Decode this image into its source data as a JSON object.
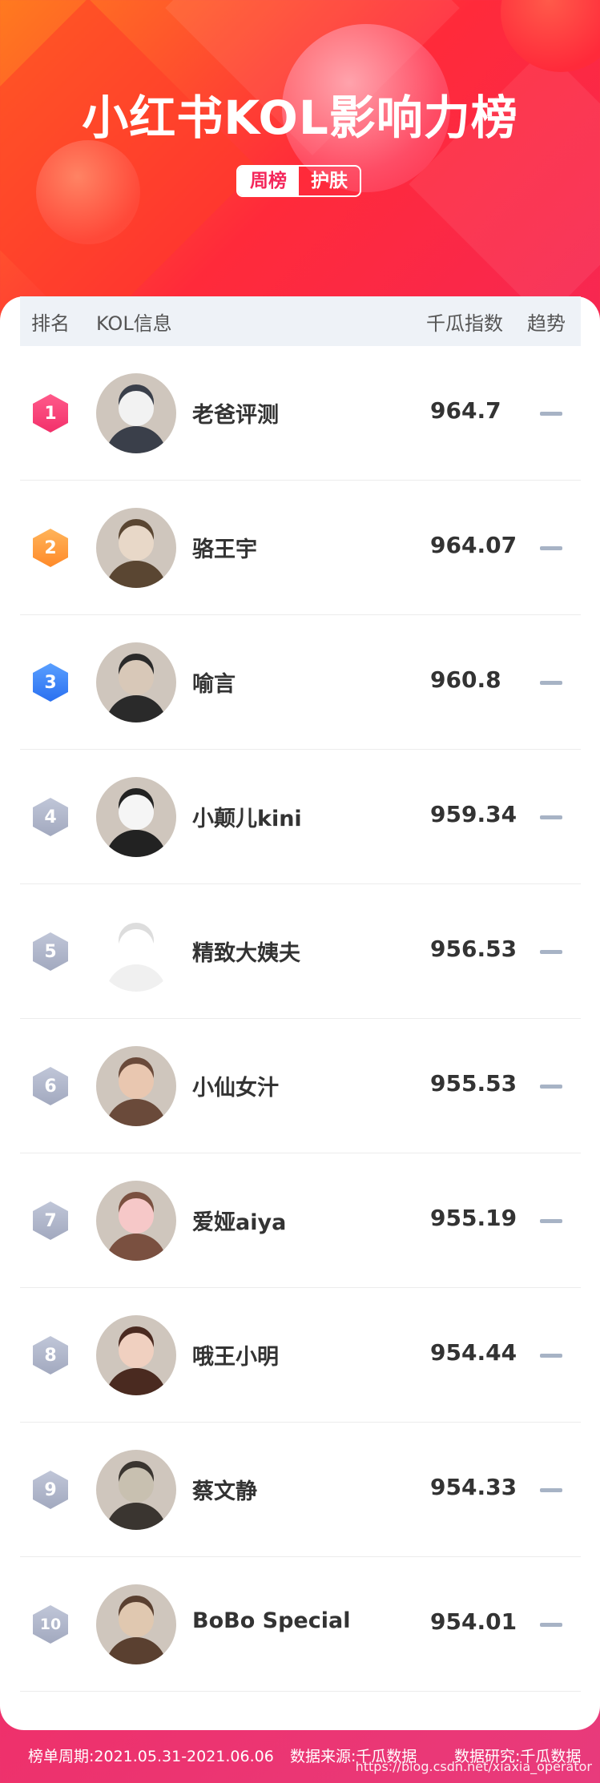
{
  "header": {
    "title": "小红书KOL影响力榜",
    "tabs": [
      {
        "label": "周榜",
        "active": true
      },
      {
        "label": "护肤",
        "active": false
      }
    ]
  },
  "table": {
    "columns": {
      "rank": "排名",
      "kol": "KOL信息",
      "index": "千瓜指数",
      "trend": "趋势"
    },
    "rows": [
      {
        "rank": "1",
        "name": "老爸评测",
        "score": "964.7",
        "avatar": "avatar-man-white-shirt"
      },
      {
        "rank": "2",
        "name": "骆王宇",
        "score": "964.07",
        "avatar": "avatar-young-man"
      },
      {
        "rank": "3",
        "name": "喻言",
        "score": "960.8",
        "avatar": "avatar-woman-dark-hair"
      },
      {
        "rank": "4",
        "name": "小颠儿kini",
        "score": "959.34",
        "avatar": "avatar-man-cap"
      },
      {
        "rank": "5",
        "name": "精致大姨夫",
        "score": "956.53",
        "avatar": "avatar-cartoon-doctor"
      },
      {
        "rank": "6",
        "name": "小仙女汁",
        "score": "955.53",
        "avatar": "avatar-woman-brown-hair"
      },
      {
        "rank": "7",
        "name": "爱娅aiya",
        "score": "955.19",
        "avatar": "avatar-woman-pink-bg"
      },
      {
        "rank": "8",
        "name": "哦王小明",
        "score": "954.44",
        "avatar": "avatar-woman-smiling"
      },
      {
        "rank": "9",
        "name": "蔡文静",
        "score": "954.33",
        "avatar": "avatar-woman-outdoor"
      },
      {
        "rank": "10",
        "name": "BoBo Special",
        "score": "954.01",
        "avatar": "avatar-woman-hat"
      }
    ]
  },
  "footer": {
    "period": "榜单周期:2021.05.31-2021.06.06",
    "source": "数据来源:千瓜数据",
    "research": "数据研究:千瓜数据",
    "watermark": "https://blog.csdn.net/xiaxia_operator"
  }
}
